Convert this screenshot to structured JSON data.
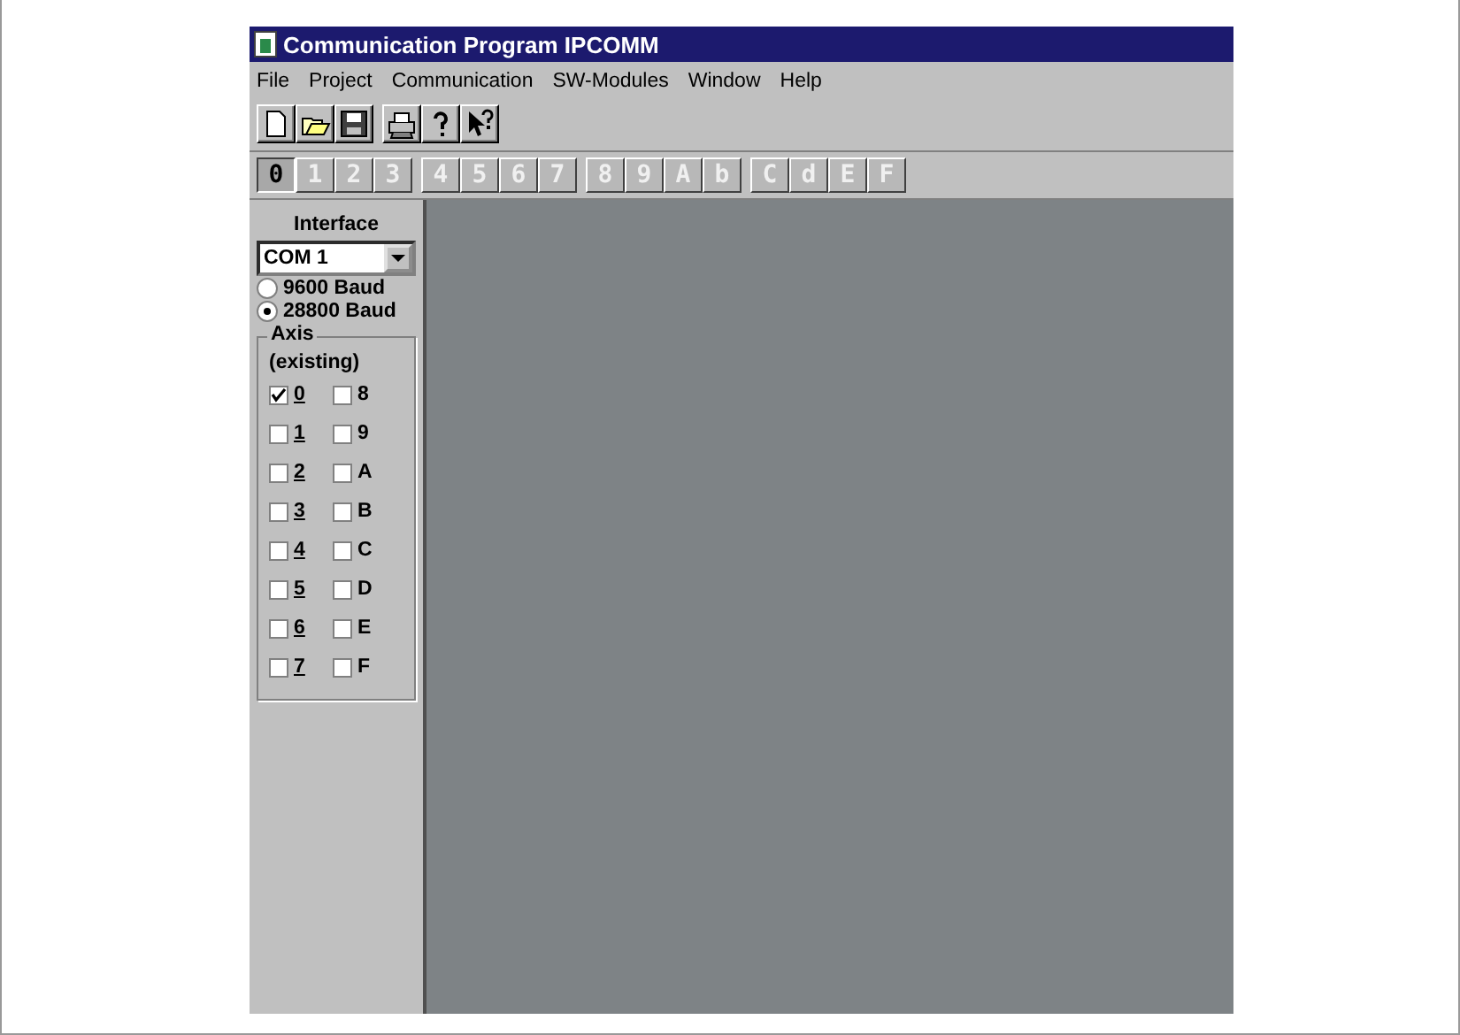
{
  "window": {
    "title": "Communication Program IPCOMM"
  },
  "menu": [
    {
      "label": "File"
    },
    {
      "label": "Project"
    },
    {
      "label": "Communication"
    },
    {
      "label": "SW-Modules"
    },
    {
      "label": "Window"
    },
    {
      "label": "Help"
    }
  ],
  "toolbar": [
    {
      "kind": "new"
    },
    {
      "kind": "open"
    },
    {
      "kind": "save"
    },
    {
      "kind": "print"
    },
    {
      "kind": "help"
    },
    {
      "kind": "context-help"
    }
  ],
  "axis_buttons": [
    {
      "label": "0",
      "selected": true
    },
    {
      "label": "1",
      "selected": false
    },
    {
      "label": "2",
      "selected": false
    },
    {
      "label": "3",
      "selected": false
    },
    {
      "label": "4",
      "selected": false
    },
    {
      "label": "5",
      "selected": false
    },
    {
      "label": "6",
      "selected": false
    },
    {
      "label": "7",
      "selected": false
    },
    {
      "label": "8",
      "selected": false
    },
    {
      "label": "9",
      "selected": false
    },
    {
      "label": "A",
      "selected": false
    },
    {
      "label": "b",
      "selected": false
    },
    {
      "label": "C",
      "selected": false
    },
    {
      "label": "d",
      "selected": false
    },
    {
      "label": "E",
      "selected": false
    },
    {
      "label": "F",
      "selected": false
    }
  ],
  "interface": {
    "title": "Interface",
    "port": "COM 1",
    "baud": [
      {
        "label": "9600 Baud",
        "selected": false
      },
      {
        "label": "28800 Baud",
        "selected": true
      }
    ]
  },
  "axis_group": {
    "title": "Axis",
    "subtitle": "(existing)",
    "axes": [
      {
        "label": "0",
        "checked": true,
        "underlined": true
      },
      {
        "label": "8",
        "checked": false,
        "underlined": false
      },
      {
        "label": "1",
        "checked": false,
        "underlined": true
      },
      {
        "label": "9",
        "checked": false,
        "underlined": false
      },
      {
        "label": "2",
        "checked": false,
        "underlined": true
      },
      {
        "label": "A",
        "checked": false,
        "underlined": false
      },
      {
        "label": "3",
        "checked": false,
        "underlined": true
      },
      {
        "label": "B",
        "checked": false,
        "underlined": false
      },
      {
        "label": "4",
        "checked": false,
        "underlined": true
      },
      {
        "label": "C",
        "checked": false,
        "underlined": false
      },
      {
        "label": "5",
        "checked": false,
        "underlined": true
      },
      {
        "label": "D",
        "checked": false,
        "underlined": false
      },
      {
        "label": "6",
        "checked": false,
        "underlined": true
      },
      {
        "label": "E",
        "checked": false,
        "underlined": false
      },
      {
        "label": "7",
        "checked": false,
        "underlined": true
      },
      {
        "label": "F",
        "checked": false,
        "underlined": false
      }
    ]
  }
}
